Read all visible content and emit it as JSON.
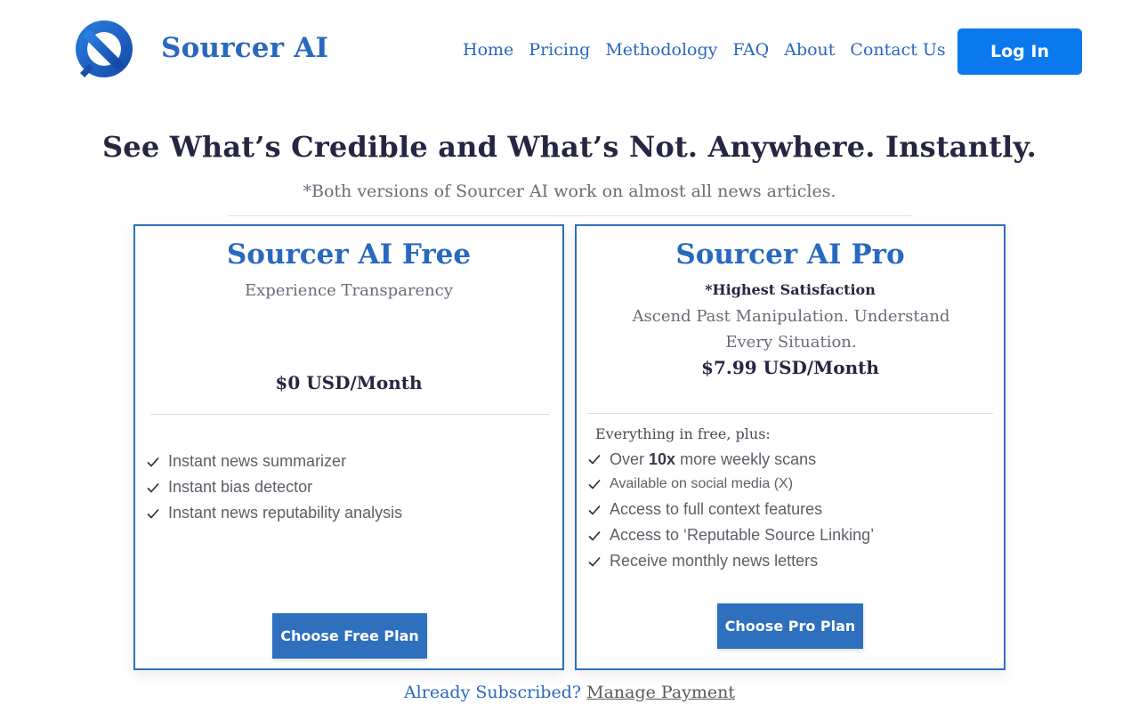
{
  "header": {
    "brand": "Sourcer AI",
    "logo_icon": "magnifier-slash-logo",
    "nav": [
      "Home",
      "Pricing",
      "Methodology",
      "FAQ",
      "About",
      "Contact Us"
    ],
    "login_label": "Log In"
  },
  "hero": {
    "headline": "See What’s Credible and What’s Not. Anywhere. Instantly.",
    "subline": "*Both versions of Sourcer AI work on almost all news articles."
  },
  "plans": {
    "free": {
      "title": "Sourcer AI Free",
      "tagline": "Experience Transparency",
      "price": "$0 USD/Month",
      "features": [
        "Instant news summarizer",
        "Instant bias detector",
        "Instant news reputability analysis"
      ],
      "button": "Choose Free Plan"
    },
    "pro": {
      "title": "Sourcer AI Pro",
      "badge": "*Highest Satisfaction",
      "tagline": "Ascend Past Manipulation. Understand Every Situation.",
      "price": "$7.99 USD/Month",
      "intro": "Everything in free, plus:",
      "feature_scans_prefix": "Over",
      "feature_scans_bold": "10x",
      "feature_scans_suffix": "more weekly scans",
      "features": [
        "Available on social media (X)",
        "Access to full context features",
        "Access to ‘Reputable Source Linking’",
        "Receive monthly news letters"
      ],
      "button": "Choose Pro Plan"
    }
  },
  "footer": {
    "prompt": "Already Subscribed?",
    "link": "Manage Payment"
  },
  "colors": {
    "brand_blue": "#2968bf",
    "login_blue": "#0b79ee",
    "card_border": "#2e6fbe",
    "heading_dark": "#262643"
  }
}
